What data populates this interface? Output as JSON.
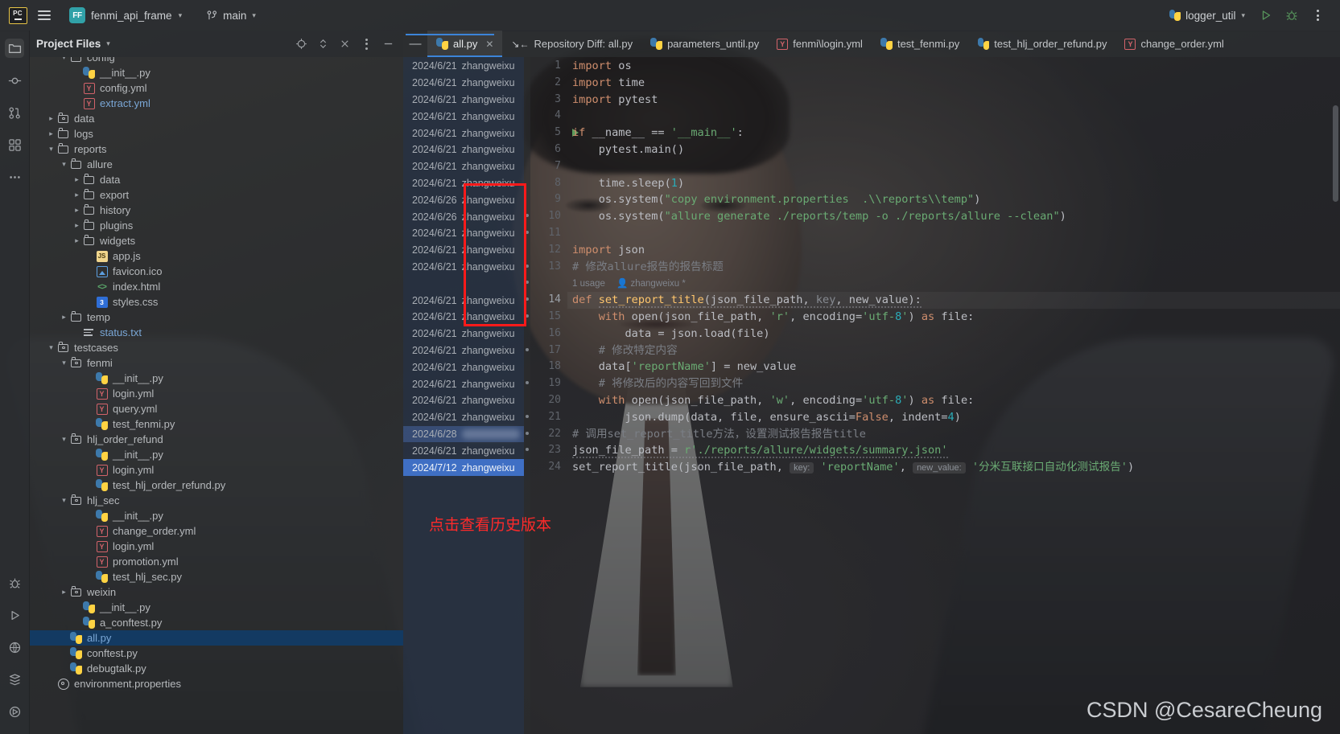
{
  "titlebar": {
    "app_icon": "pycharm-logo",
    "menu_icon": "hamburger-menu-icon",
    "project_badge": "FF",
    "project_name": "fenmi_api_frame",
    "branch_icon": "git-branch-icon",
    "branch_name": "main",
    "run_config": "logger_util",
    "run_icon": "run-button-icon",
    "debug_icon": "debug-button-icon",
    "more_icon": "more-options-icon"
  },
  "activitybar": {
    "items": [
      {
        "name": "project-tool-window",
        "icon": "folder-icon",
        "selected": true
      },
      {
        "name": "commit-tool-window",
        "icon": "commit-icon",
        "selected": false
      },
      {
        "name": "pull-requests-tool-window",
        "icon": "pull-request-icon",
        "selected": false
      },
      {
        "name": "structure-tool-window",
        "icon": "structure-icon",
        "selected": false
      },
      {
        "name": "more-tool-windows",
        "icon": "ellipsis-icon",
        "selected": false
      }
    ],
    "bottom_items": [
      {
        "name": "debug-tool-window",
        "icon": "bug-icon"
      },
      {
        "name": "run-tool-window",
        "icon": "play-icon"
      },
      {
        "name": "python-packages-tool-window",
        "icon": "python-packages-icon"
      },
      {
        "name": "database-tool-window",
        "icon": "database-icon"
      },
      {
        "name": "services-tool-window",
        "icon": "services-icon"
      }
    ]
  },
  "project_panel": {
    "title": "Project Files",
    "title_caret": "chevron-down-icon",
    "header_icons": [
      "locate-icon",
      "expand-collapse-icon",
      "close-icon",
      "options-icon",
      "hide-icon"
    ],
    "tree": [
      {
        "indent": 2,
        "arrow": "down",
        "icon": "folder",
        "label": "config",
        "color": "dim",
        "clipped": true
      },
      {
        "indent": 3,
        "arrow": "none",
        "icon": "py",
        "label": "__init__.py",
        "color": "dim"
      },
      {
        "indent": 3,
        "arrow": "none",
        "icon": "yml",
        "label": "config.yml",
        "color": "dim"
      },
      {
        "indent": 3,
        "arrow": "none",
        "icon": "yml",
        "label": "extract.yml",
        "color": "blue"
      },
      {
        "indent": 1,
        "arrow": "right",
        "icon": "folder-src",
        "label": "data",
        "color": "dim"
      },
      {
        "indent": 1,
        "arrow": "right",
        "icon": "folder",
        "label": "logs",
        "color": "dim"
      },
      {
        "indent": 1,
        "arrow": "down",
        "icon": "folder",
        "label": "reports",
        "color": "dim"
      },
      {
        "indent": 2,
        "arrow": "down",
        "icon": "folder",
        "label": "allure",
        "color": "dim"
      },
      {
        "indent": 3,
        "arrow": "right",
        "icon": "folder",
        "label": "data",
        "color": "dim"
      },
      {
        "indent": 3,
        "arrow": "right",
        "icon": "folder",
        "label": "export",
        "color": "dim"
      },
      {
        "indent": 3,
        "arrow": "right",
        "icon": "folder",
        "label": "history",
        "color": "dim"
      },
      {
        "indent": 3,
        "arrow": "right",
        "icon": "folder",
        "label": "plugins",
        "color": "dim"
      },
      {
        "indent": 3,
        "arrow": "right",
        "icon": "folder",
        "label": "widgets",
        "color": "dim"
      },
      {
        "indent": 4,
        "arrow": "none",
        "icon": "js",
        "label": "app.js",
        "color": "dim"
      },
      {
        "indent": 4,
        "arrow": "none",
        "icon": "img",
        "label": "favicon.ico",
        "color": "dim"
      },
      {
        "indent": 4,
        "arrow": "none",
        "icon": "html",
        "label": "index.html",
        "color": "dim"
      },
      {
        "indent": 4,
        "arrow": "none",
        "icon": "css",
        "label": "styles.css",
        "color": "dim"
      },
      {
        "indent": 2,
        "arrow": "right",
        "icon": "folder",
        "label": "temp",
        "color": "dim"
      },
      {
        "indent": 3,
        "arrow": "none",
        "icon": "txt",
        "label": "status.txt",
        "color": "blue"
      },
      {
        "indent": 1,
        "arrow": "down",
        "icon": "folder-src",
        "label": "testcases",
        "color": "dim"
      },
      {
        "indent": 2,
        "arrow": "down",
        "icon": "folder-src",
        "label": "fenmi",
        "color": "dim"
      },
      {
        "indent": 4,
        "arrow": "none",
        "icon": "py",
        "label": "__init__.py",
        "color": "dim"
      },
      {
        "indent": 4,
        "arrow": "none",
        "icon": "yml",
        "label": "login.yml",
        "color": "dim"
      },
      {
        "indent": 4,
        "arrow": "none",
        "icon": "yml",
        "label": "query.yml",
        "color": "dim"
      },
      {
        "indent": 4,
        "arrow": "none",
        "icon": "py",
        "label": "test_fenmi.py",
        "color": "dim"
      },
      {
        "indent": 2,
        "arrow": "down",
        "icon": "folder-src",
        "label": "hlj_order_refund",
        "color": "dim"
      },
      {
        "indent": 4,
        "arrow": "none",
        "icon": "py",
        "label": "__init__.py",
        "color": "dim"
      },
      {
        "indent": 4,
        "arrow": "none",
        "icon": "yml",
        "label": "login.yml",
        "color": "dim"
      },
      {
        "indent": 4,
        "arrow": "none",
        "icon": "py",
        "label": "test_hlj_order_refund.py",
        "color": "dim"
      },
      {
        "indent": 2,
        "arrow": "down",
        "icon": "folder-src",
        "label": "hlj_sec",
        "color": "dim"
      },
      {
        "indent": 4,
        "arrow": "none",
        "icon": "py",
        "label": "__init__.py",
        "color": "dim"
      },
      {
        "indent": 4,
        "arrow": "none",
        "icon": "yml",
        "label": "change_order.yml",
        "color": "dim"
      },
      {
        "indent": 4,
        "arrow": "none",
        "icon": "yml",
        "label": "login.yml",
        "color": "dim"
      },
      {
        "indent": 4,
        "arrow": "none",
        "icon": "yml",
        "label": "promotion.yml",
        "color": "dim"
      },
      {
        "indent": 4,
        "arrow": "none",
        "icon": "py",
        "label": "test_hlj_sec.py",
        "color": "dim"
      },
      {
        "indent": 2,
        "arrow": "right",
        "icon": "folder-src",
        "label": "weixin",
        "color": "dim"
      },
      {
        "indent": 3,
        "arrow": "none",
        "icon": "py",
        "label": "__init__.py",
        "color": "dim"
      },
      {
        "indent": 3,
        "arrow": "none",
        "icon": "py",
        "label": "a_conftest.py",
        "color": "dim"
      },
      {
        "indent": 2,
        "arrow": "none",
        "icon": "py",
        "label": "all.py",
        "color": "blue",
        "selected": true
      },
      {
        "indent": 2,
        "arrow": "none",
        "icon": "py",
        "label": "conftest.py",
        "color": "dim"
      },
      {
        "indent": 2,
        "arrow": "none",
        "icon": "py",
        "label": "debugtalk.py",
        "color": "dim"
      },
      {
        "indent": 1,
        "arrow": "none",
        "icon": "gear",
        "label": "environment.properties",
        "color": "dim"
      }
    ]
  },
  "tabs": [
    {
      "label": "all.py",
      "icon": "python-file-icon",
      "active": true,
      "closable": true
    },
    {
      "label": "Repository Diff: all.py",
      "icon": "diff-icon",
      "active": false,
      "closable": false
    },
    {
      "label": "parameters_until.py",
      "icon": "python-file-icon",
      "active": false,
      "closable": false
    },
    {
      "label": "fenmi\\login.yml",
      "icon": "yaml-file-icon",
      "active": false,
      "closable": false
    },
    {
      "label": "test_fenmi.py",
      "icon": "python-file-icon",
      "active": false,
      "closable": false
    },
    {
      "label": "test_hlj_order_refund.py",
      "icon": "python-file-icon",
      "active": false,
      "closable": false
    },
    {
      "label": "change_order.yml",
      "icon": "yaml-file-icon",
      "active": false,
      "closable": false
    }
  ],
  "annotations": [
    {
      "line": 1,
      "date": "2024/6/21",
      "author": "zhangweixu"
    },
    {
      "line": 2,
      "date": "2024/6/21",
      "author": "zhangweixu"
    },
    {
      "line": 3,
      "date": "2024/6/21",
      "author": "zhangweixu"
    },
    {
      "line": 4,
      "date": "2024/6/21",
      "author": "zhangweixu"
    },
    {
      "line": 5,
      "date": "2024/6/21",
      "author": "zhangweixu"
    },
    {
      "line": 6,
      "date": "2024/6/21",
      "author": "zhangweixu"
    },
    {
      "line": 7,
      "date": "2024/6/21",
      "author": "zhangweixu"
    },
    {
      "line": 8,
      "date": "2024/6/21",
      "author": "zhangweixu"
    },
    {
      "line": 9,
      "date": "2024/6/26",
      "author": "zhangweixu"
    },
    {
      "line": 10,
      "date": "2024/6/26",
      "author": "zhangweixu"
    },
    {
      "line": 11,
      "date": "2024/6/21",
      "author": "zhangweixu"
    },
    {
      "line": 12,
      "date": "2024/6/21",
      "author": "zhangweixu"
    },
    {
      "line": 13,
      "date": "2024/6/21",
      "author": "zhangweixu"
    },
    {
      "line": 0,
      "date": "",
      "author": ""
    },
    {
      "line": 14,
      "date": "2024/6/21",
      "author": "zhangweixu"
    },
    {
      "line": 15,
      "date": "2024/6/21",
      "author": "zhangweixu"
    },
    {
      "line": 16,
      "date": "2024/6/21",
      "author": "zhangweixu"
    },
    {
      "line": 17,
      "date": "2024/6/21",
      "author": "zhangweixu"
    },
    {
      "line": 18,
      "date": "2024/6/21",
      "author": "zhangweixu"
    },
    {
      "line": 19,
      "date": "2024/6/21",
      "author": "zhangweixu"
    },
    {
      "line": 20,
      "date": "2024/6/21",
      "author": "zhangweixu"
    },
    {
      "line": 21,
      "date": "2024/6/21",
      "author": "zhangweixu"
    },
    {
      "line": 22,
      "date": "2024/6/28",
      "author": "",
      "blurred": true,
      "highlight": "soft"
    },
    {
      "line": 23,
      "date": "2024/6/21",
      "author": "zhangweixu"
    },
    {
      "line": 24,
      "date": "2024/7/12",
      "author": "zhangweixu",
      "highlight": "strong"
    }
  ],
  "code_lines": [
    {
      "num": "1",
      "text": "import os"
    },
    {
      "num": "2",
      "text": "import time"
    },
    {
      "num": "3",
      "text": "import pytest"
    },
    {
      "num": "4",
      "text": ""
    },
    {
      "num": "5",
      "text": "if __name__ == '__main__':",
      "has_run_marker": true
    },
    {
      "num": "6",
      "text": "    pytest.main()"
    },
    {
      "num": "7",
      "text": ""
    },
    {
      "num": "8",
      "text": "    time.sleep(1)"
    },
    {
      "num": "9",
      "text": "    os.system(\"copy environment.properties  .\\\\reports\\\\temp\")"
    },
    {
      "num": "10",
      "text": "    os.system(\"allure generate ./reports/temp -o ./reports/allure --clean\")"
    },
    {
      "num": "11",
      "text": ""
    },
    {
      "num": "12",
      "text": "import json"
    },
    {
      "num": "13",
      "text": "# 修改allure报告的报告标题"
    },
    {
      "num": "",
      "text": "1 usage    zhangweixu *",
      "is_inlay": true
    },
    {
      "num": "14",
      "text": "def set_report_title(json_file_path, key, new_value):",
      "current": true
    },
    {
      "num": "15",
      "text": "    with open(json_file_path, 'r', encoding='utf-8') as file:"
    },
    {
      "num": "16",
      "text": "        data = json.load(file)"
    },
    {
      "num": "17",
      "text": "    # 修改特定内容"
    },
    {
      "num": "18",
      "text": "    data['reportName'] = new_value"
    },
    {
      "num": "19",
      "text": "    # 将修改后的内容写回到文件"
    },
    {
      "num": "20",
      "text": "    with open(json_file_path, 'w', encoding='utf-8') as file:"
    },
    {
      "num": "21",
      "text": "        json.dump(data, file, ensure_ascii=False, indent=4)"
    },
    {
      "num": "22",
      "text": "# 调用set_report_title方法，设置测试报告报告title"
    },
    {
      "num": "23",
      "text": "json_file_path = r'./reports/allure/widgets/summary.json'"
    },
    {
      "num": "24",
      "text": "set_report_title(json_file_path,  key: 'reportName',  new_value: '分米互联接口自动化测试报告')"
    }
  ],
  "inlay_hints": {
    "usage_count": "1 usage",
    "author": "zhangweixu *",
    "key_hint": "key:",
    "new_value_hint": "new_value:"
  },
  "overlays": {
    "red_note": "点击查看历史版本",
    "red_color": "#ff2a2a",
    "watermark": "CSDN @CesareCheung"
  }
}
